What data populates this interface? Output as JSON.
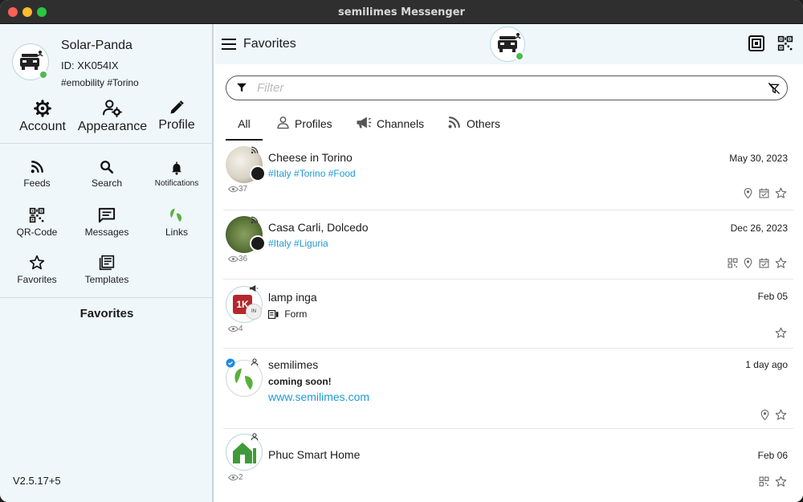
{
  "window": {
    "title": "semilimes Messenger"
  },
  "profile": {
    "name": "Solar-Panda",
    "id": "ID: XK054IX",
    "tags": "#emobility #Torino"
  },
  "top_actions": {
    "account": "Account",
    "appearance": "Appearance",
    "profile": "Profile"
  },
  "menu": {
    "feeds": "Feeds",
    "search": "Search",
    "notifications": "Notifications",
    "qr_code": "QR-Code",
    "messages": "Messages",
    "links": "Links",
    "favorites": "Favorites",
    "templates": "Templates"
  },
  "sidebar_section": "Favorites",
  "version": "V2.5.17+5",
  "header": {
    "title": "Favorites"
  },
  "filter": {
    "placeholder": "Filter",
    "value": ""
  },
  "tabs": {
    "all": "All",
    "profiles": "Profiles",
    "channels": "Channels",
    "others": "Others"
  },
  "feed": [
    {
      "name": "Cheese in Torino",
      "date": "May 30, 2023",
      "tags": "#Italy #Torino #Food",
      "views": "37"
    },
    {
      "name": "Casa Carli, Dolcedo",
      "date": "Dec 26, 2023",
      "tags": "#Italy #Liguria",
      "views": "36"
    },
    {
      "name": "lamp inga",
      "date": "Feb 05",
      "subtitle": "Form",
      "views": "4",
      "avatar_text": "1K",
      "badge_text": "IN"
    },
    {
      "name": "semilimes",
      "date": "1 day ago",
      "line1": "coming soon!",
      "link": "www.semilimes.com"
    },
    {
      "name": "Phuc Smart Home",
      "date": "Feb 06",
      "views": "2"
    }
  ],
  "colors": {
    "sidebar_bg": "#eff7fb",
    "online_green": "#4cbb4f",
    "tag_blue": "#1e9ad6",
    "semilimes_green": "#5aaf3c"
  }
}
